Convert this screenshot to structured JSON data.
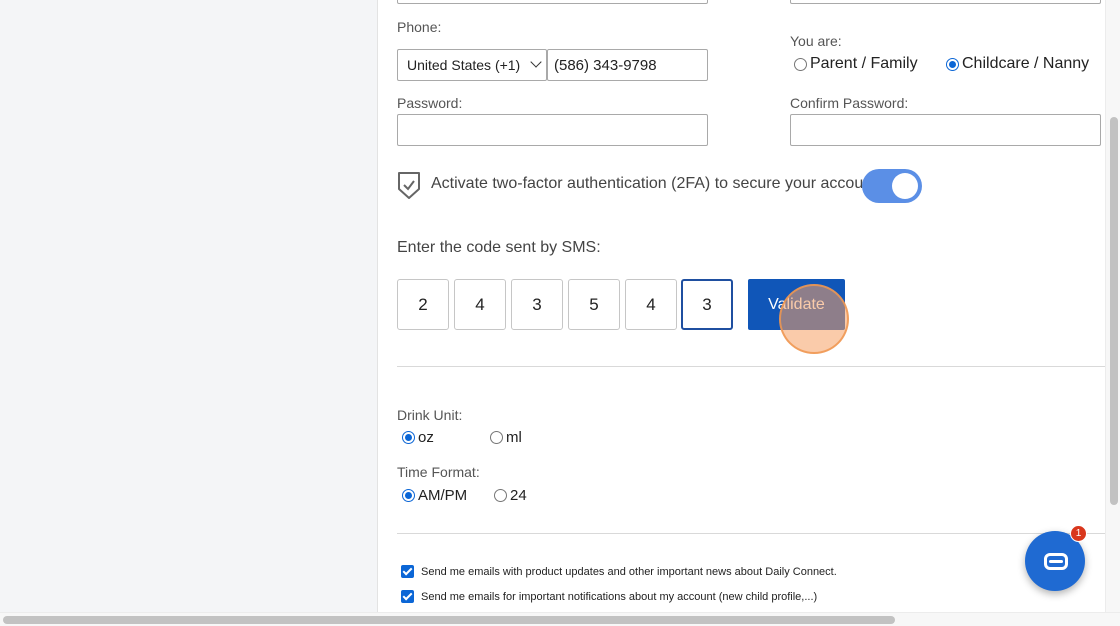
{
  "form": {
    "phone_label": "Phone:",
    "country_selected": "United States (+1)",
    "phone_value": "(586) 343-9798",
    "you_are_label": "You are:",
    "role_options": [
      "Parent / Family",
      "Childcare / Nanny"
    ],
    "role_selected": "Childcare / Nanny",
    "password_label": "Password:",
    "confirm_password_label": "Confirm Password:",
    "twofa_text": "Activate two-factor authentication (2FA) to secure your account.",
    "twofa_enabled": true,
    "sms_label": "Enter the code sent by SMS:",
    "code_digits": [
      "2",
      "4",
      "3",
      "5",
      "4",
      "3"
    ],
    "validate_label": "Validate",
    "drink_unit_label": "Drink Unit:",
    "drink_unit_options": [
      "oz",
      "ml"
    ],
    "drink_unit_selected": "oz",
    "time_format_label": "Time Format:",
    "time_format_options": [
      "AM/PM",
      "24"
    ],
    "time_format_selected": "AM/PM",
    "email_opt_1": "Send me emails with product updates and other important news about Daily Connect.",
    "email_opt_2": "Send me emails for important notifications about my account (new child profile,...)"
  },
  "chat": {
    "badge_count": "1"
  },
  "colors": {
    "accent": "#1056b8",
    "toggle_on": "#5b8fe6",
    "badge": "#d9371d"
  }
}
